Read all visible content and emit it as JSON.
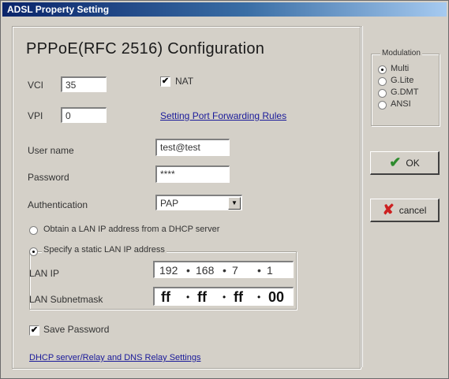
{
  "window": {
    "title": "ADSL Property Setting"
  },
  "config": {
    "heading": "PPPoE(RFC 2516) Configuration",
    "vci_label": "VCI",
    "vci_value": "35",
    "vpi_label": "VPI",
    "vpi_value": "0",
    "nat_label": "NAT",
    "nat_checked": "✔",
    "port_forwarding_link": "Setting Port Forwarding Rules",
    "username_label": "User name",
    "username_value": "test@test",
    "password_label": "Password",
    "password_value": "****",
    "auth_label": "Authentication",
    "auth_value": "PAP",
    "dhcp_option_label": "Obtain a LAN IP address from a DHCP server",
    "static_option_label": "Specify a static LAN IP address",
    "lan_ip_label": "LAN IP",
    "lan_ip": [
      "192",
      "168",
      "7",
      "1"
    ],
    "lan_mask_label": "LAN Subnetmask",
    "lan_mask": [
      "ff",
      "ff",
      "ff",
      "00"
    ],
    "save_password_label": "Save Password",
    "save_password_checked": "✔",
    "dhcp_relay_link": "DHCP server/Relay and DNS Relay Settings"
  },
  "modulation": {
    "label": "Modulation",
    "options": [
      "Multi",
      "G.Lite",
      "G.DMT",
      "ANSI"
    ],
    "selected": "Multi"
  },
  "buttons": {
    "ok_label": "OK",
    "cancel_label": "cancel",
    "ok_icon": "check-icon",
    "cancel_icon": "x-icon"
  },
  "colors": {
    "ok_icon": "#2e8b2e",
    "cancel_icon": "#cc2020",
    "link": "#1a1a9a"
  }
}
